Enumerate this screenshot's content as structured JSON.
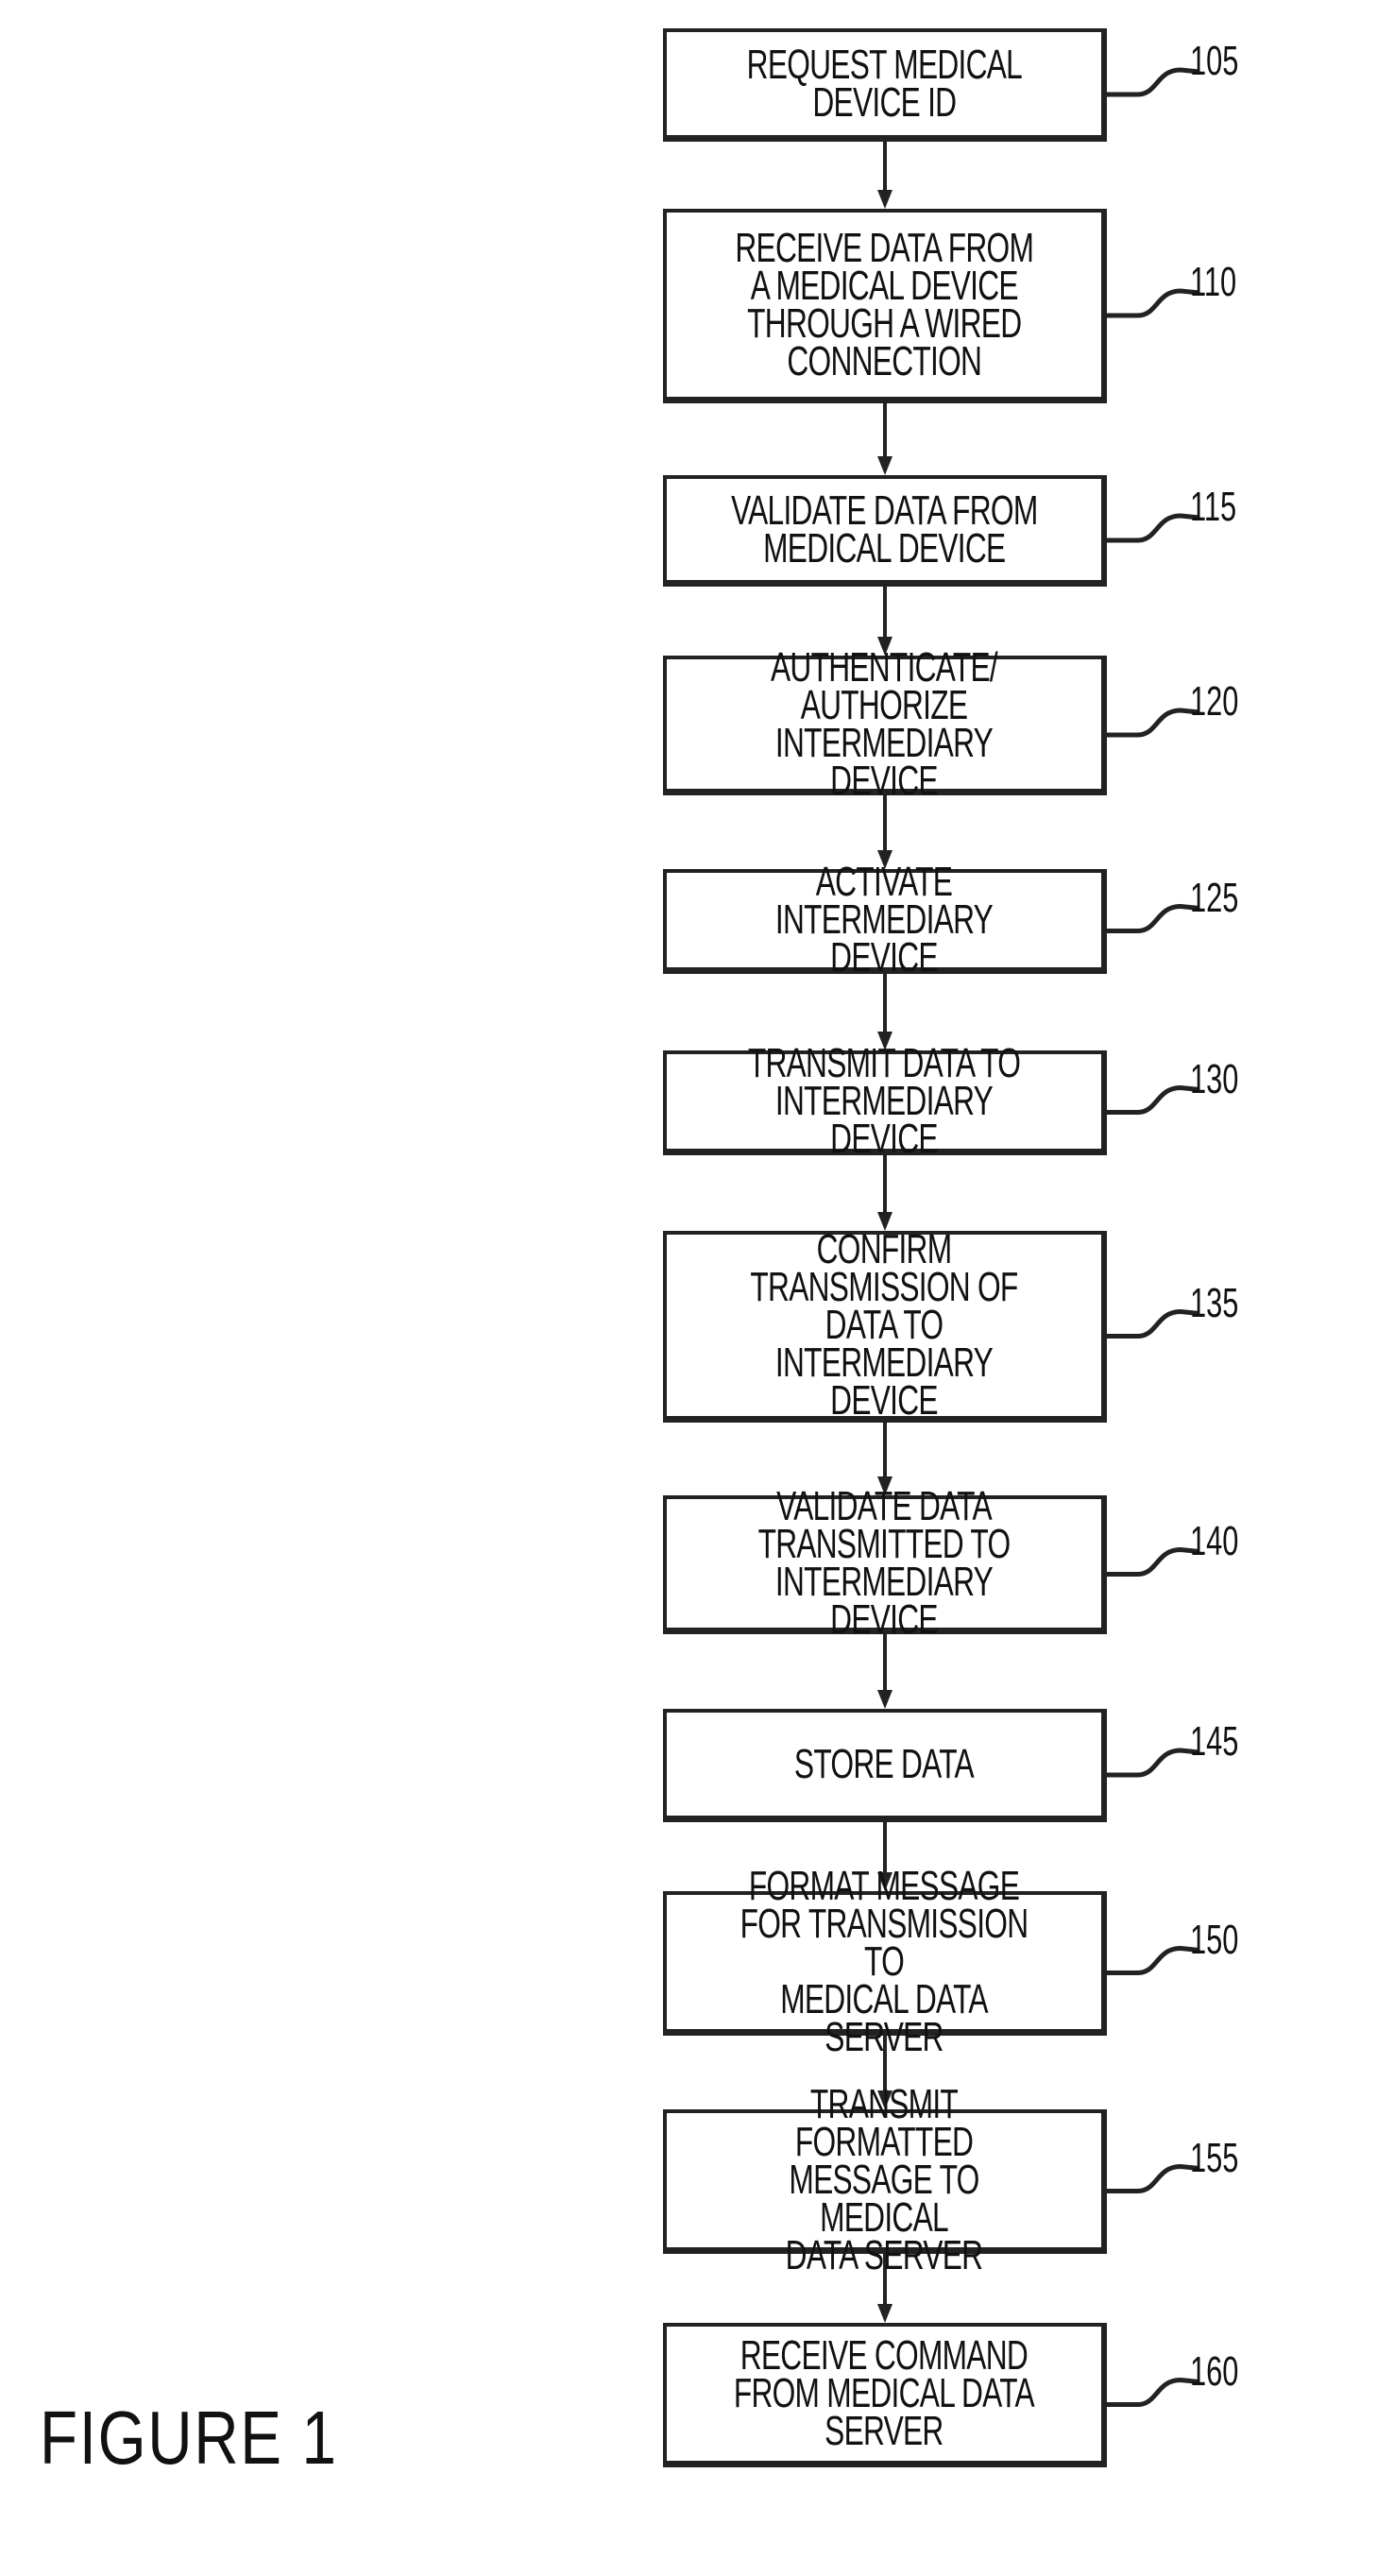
{
  "figure_label": "FIGURE 1",
  "steps": [
    {
      "ref": "105",
      "text": "REQUEST MEDICAL\nDEVICE ID"
    },
    {
      "ref": "110",
      "text": "RECEIVE DATA FROM\nA MEDICAL DEVICE\nTHROUGH A WIRED\nCONNECTION"
    },
    {
      "ref": "115",
      "text": "VALIDATE DATA FROM\nMEDICAL DEVICE"
    },
    {
      "ref": "120",
      "text": "AUTHENTICATE/\nAUTHORIZE\nINTERMEDIARY DEVICE"
    },
    {
      "ref": "125",
      "text": "ACTIVATE\nINTERMEDIARY DEVICE"
    },
    {
      "ref": "130",
      "text": "TRANSMIT DATA TO\nINTERMEDIARY DEVICE"
    },
    {
      "ref": "135",
      "text": "CONFIRM\nTRANSMISSION OF\nDATA TO\nINTERMEDIARY DEVICE"
    },
    {
      "ref": "140",
      "text": "VALIDATE DATA\nTRANSMITTED TO\nINTERMEDIARY DEVICE"
    },
    {
      "ref": "145",
      "text": "STORE DATA"
    },
    {
      "ref": "150",
      "text": "FORMAT MESSAGE\nFOR TRANSMISSION TO\nMEDICAL DATA SERVER"
    },
    {
      "ref": "155",
      "text": "TRANSMIT FORMATTED\nMESSAGE TO MEDICAL\nDATA SERVER"
    },
    {
      "ref": "160",
      "text": "RECEIVE COMMAND\nFROM MEDICAL DATA\nSERVER"
    }
  ]
}
